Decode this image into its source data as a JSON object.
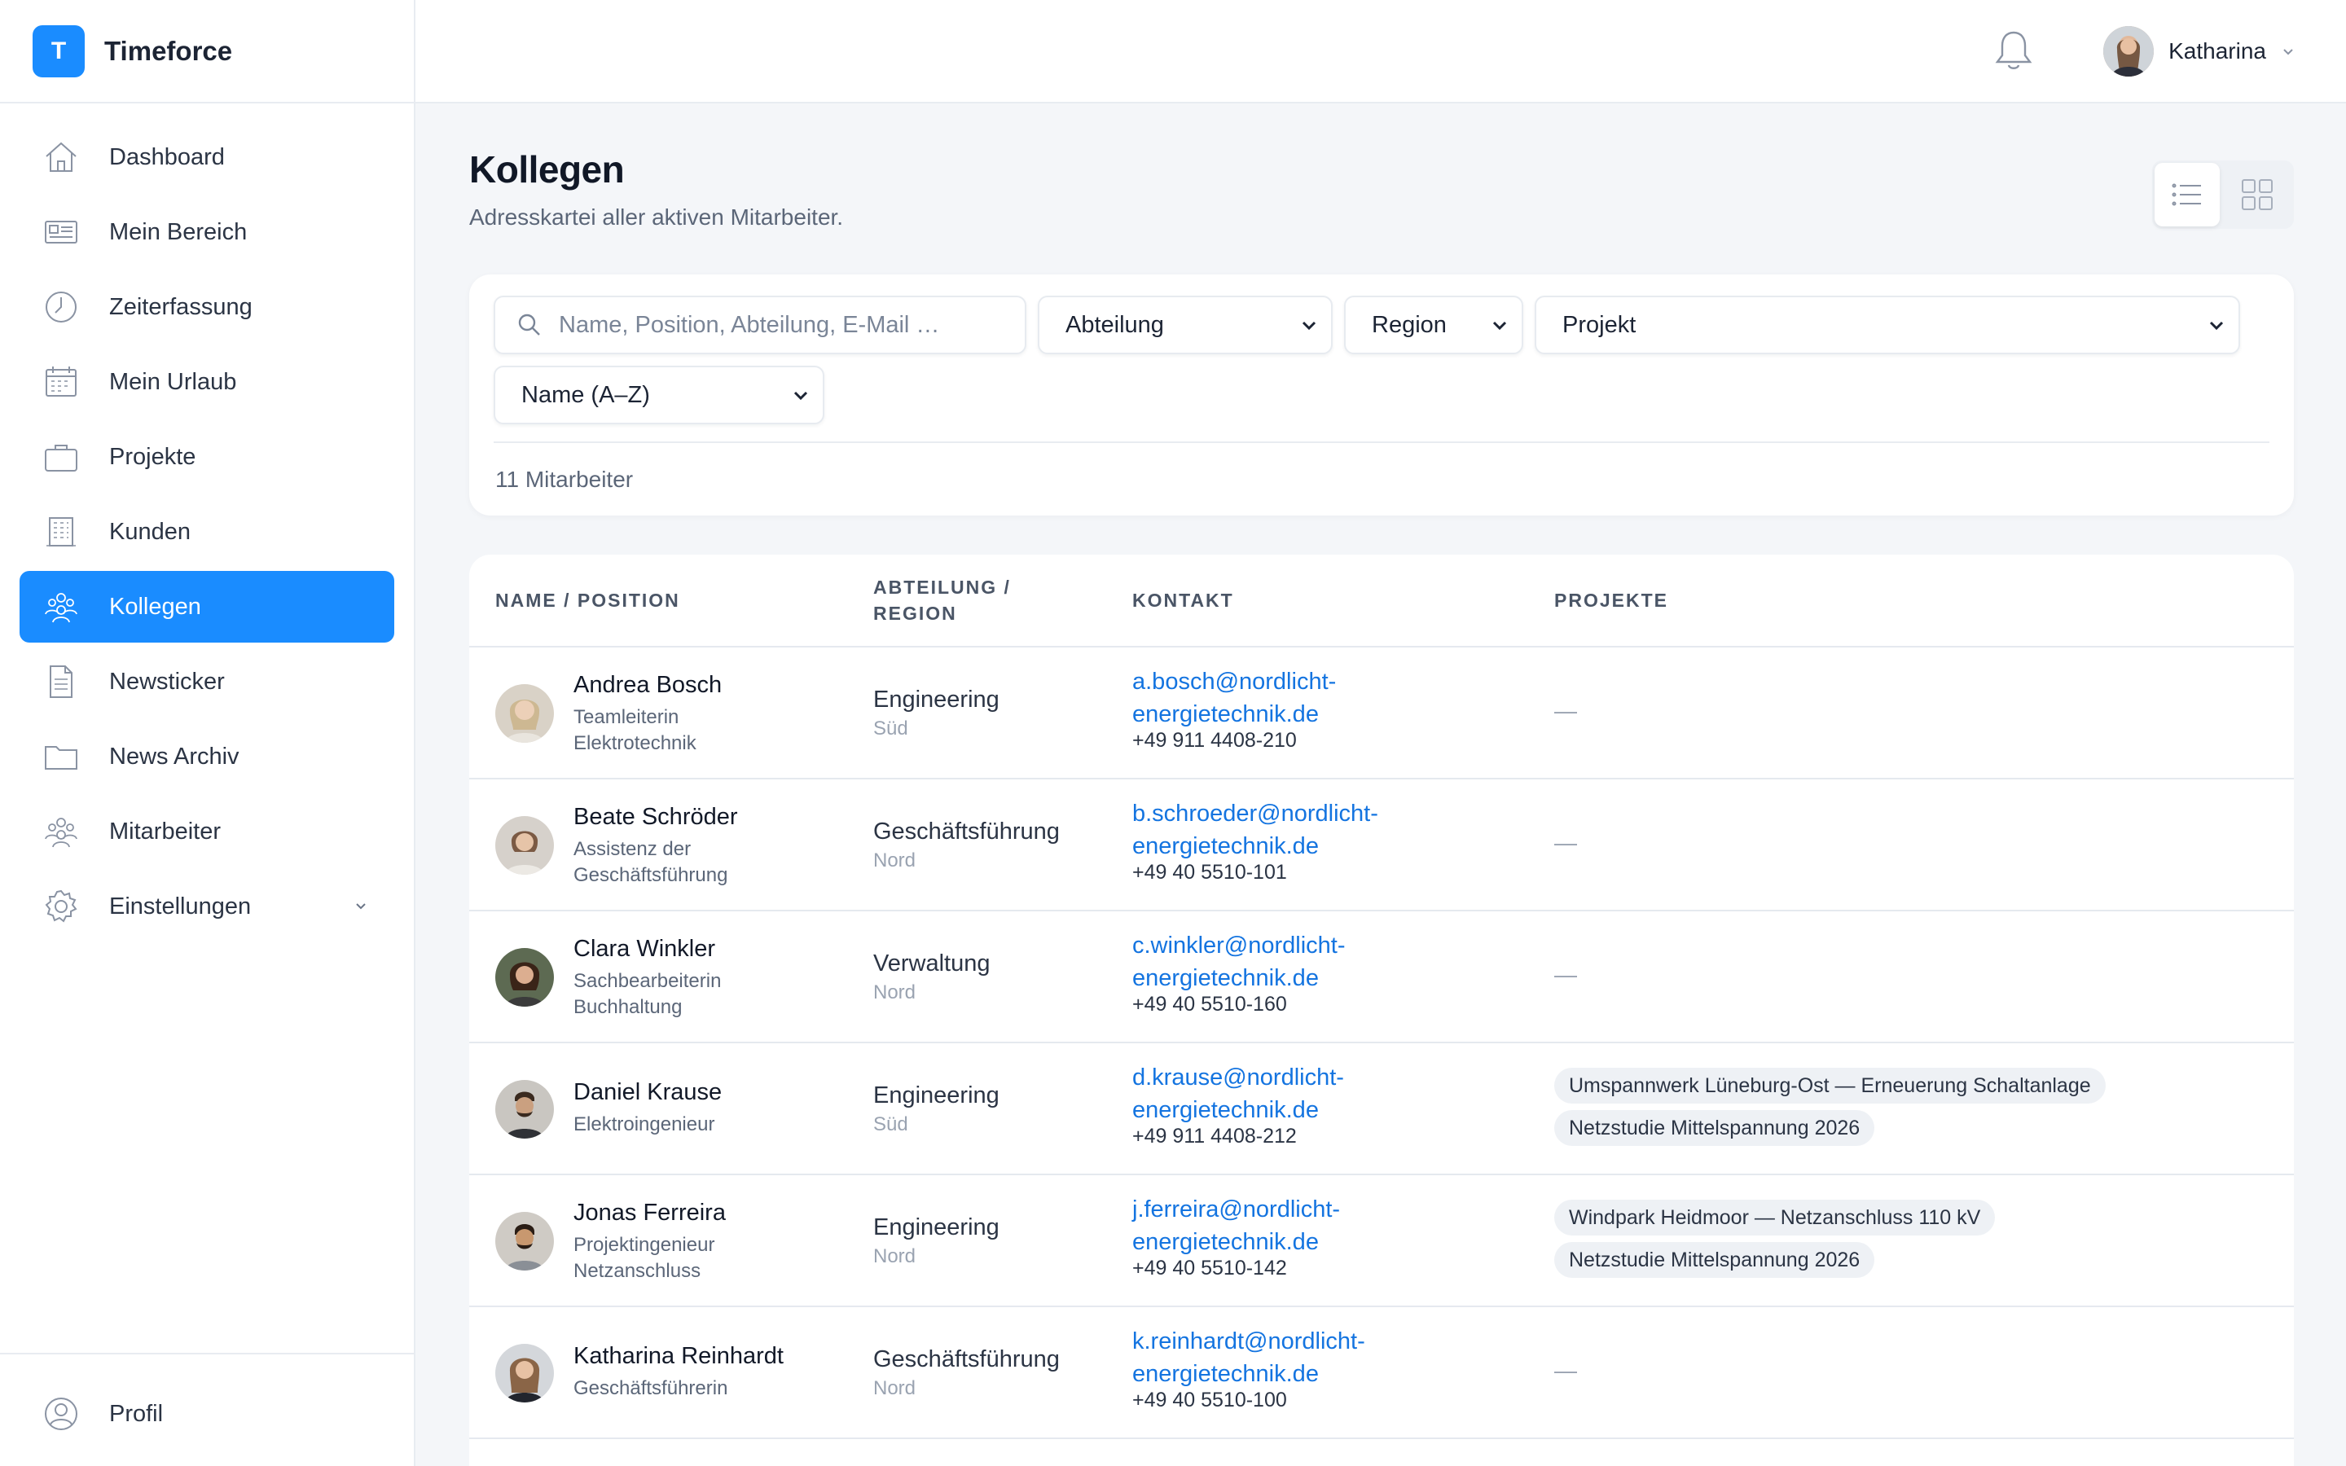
{
  "brand": {
    "logo_letter": "T",
    "name": "Timeforce"
  },
  "sidebar": {
    "items": [
      {
        "label": "Dashboard",
        "icon": "home-icon"
      },
      {
        "label": "Mein Bereich",
        "icon": "id-card-icon"
      },
      {
        "label": "Zeiterfassung",
        "icon": "clock-icon"
      },
      {
        "label": "Mein Urlaub",
        "icon": "calendar-icon"
      },
      {
        "label": "Projekte",
        "icon": "briefcase-icon"
      },
      {
        "label": "Kunden",
        "icon": "building-icon"
      },
      {
        "label": "Kollegen",
        "icon": "team-icon",
        "active": true
      },
      {
        "label": "Newsticker",
        "icon": "document-icon"
      },
      {
        "label": "News Archiv",
        "icon": "folder-icon"
      },
      {
        "label": "Mitarbeiter",
        "icon": "people-icon"
      },
      {
        "label": "Einstellungen",
        "icon": "gear-icon"
      }
    ],
    "profile_label": "Profil"
  },
  "topbar": {
    "user_name": "Katharina"
  },
  "page": {
    "title": "Kollegen",
    "subtitle": "Adresskartei aller aktiven Mitarbeiter."
  },
  "filters": {
    "search_placeholder": "Name, Position, Abteilung, E-Mail …",
    "department": "Abteilung",
    "region": "Region",
    "project": "Projekt",
    "sort": "Name (A–Z)",
    "count_label": "11 Mitarbeiter"
  },
  "table": {
    "headers": {
      "name": "NAME / POSITION",
      "dept_line1": "ABTEILUNG /",
      "dept_line2": "REGION",
      "contact": "KONTAKT",
      "projects": "PROJEKTE"
    },
    "rows": [
      {
        "name": "Andrea Bosch",
        "pos1": "Teamleiterin",
        "pos2": "Elektrotechnik",
        "dept": "Engineering",
        "region": "Süd",
        "mail1": "a.bosch@nordlicht-",
        "mail2": "energietechnik.de",
        "phone": "+49 911 4408-210",
        "projects": []
      },
      {
        "name": "Beate Schröder",
        "pos1": "Assistenz der",
        "pos2": "Geschäftsführung",
        "dept": "Geschäftsführung",
        "region": "Nord",
        "mail1": "b.schroeder@nordlicht-",
        "mail2": "energietechnik.de",
        "phone": "+49 40 5510-101",
        "projects": []
      },
      {
        "name": "Clara Winkler",
        "pos1": "Sachbearbeiterin",
        "pos2": "Buchhaltung",
        "dept": "Verwaltung",
        "region": "Nord",
        "mail1": "c.winkler@nordlicht-",
        "mail2": "energietechnik.de",
        "phone": "+49 40 5510-160",
        "projects": []
      },
      {
        "name": "Daniel Krause",
        "pos1": "Elektroingenieur",
        "pos2": "",
        "dept": "Engineering",
        "region": "Süd",
        "mail1": "d.krause@nordlicht-",
        "mail2": "energietechnik.de",
        "phone": "+49 911 4408-212",
        "projects": [
          "Umspannwerk Lüneburg-Ost — Erneuerung Schaltanlage",
          "Netzstudie Mittelspannung 2026"
        ]
      },
      {
        "name": "Jonas Ferreira",
        "pos1": "Projektingenieur",
        "pos2": "Netzanschluss",
        "dept": "Engineering",
        "region": "Nord",
        "mail1": "j.ferreira@nordlicht-",
        "mail2": "energietechnik.de",
        "phone": "+49 40 5510-142",
        "projects": [
          "Windpark Heidmoor — Netzanschluss 110 kV",
          "Netzstudie Mittelspannung 2026"
        ]
      },
      {
        "name": "Katharina Reinhardt",
        "pos1": "Geschäftsführerin",
        "pos2": "",
        "dept": "Geschäftsführung",
        "region": "Nord",
        "mail1": "k.reinhardt@nordlicht-",
        "mail2": "energietechnik.de",
        "phone": "+49 40 5510-100",
        "projects": []
      }
    ],
    "empty_project": "—"
  },
  "colors": {
    "accent": "#1a8cff",
    "link": "#1474e0"
  }
}
